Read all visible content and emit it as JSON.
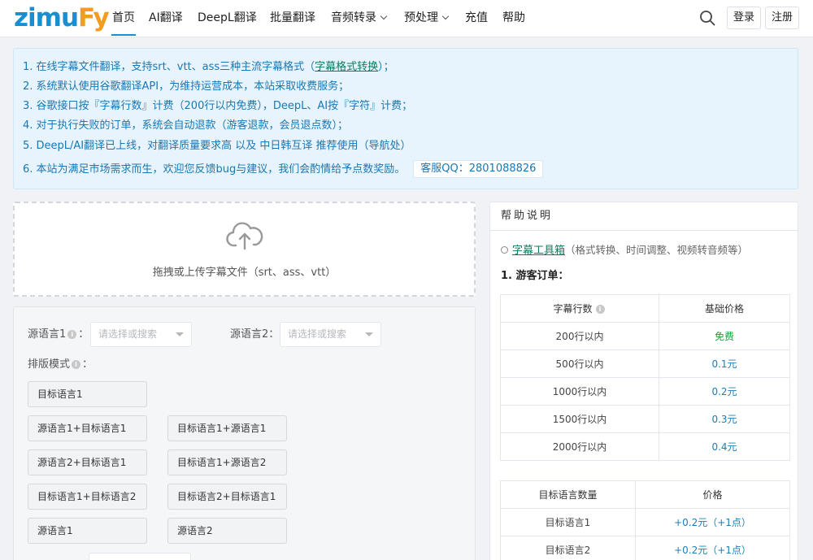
{
  "logo": {
    "part1": "zimu",
    "part2": "Fy"
  },
  "nav": {
    "items": [
      "首页",
      "AI翻译",
      "DeepL翻译",
      "批量翻译",
      "音频转录",
      "预处理",
      "充值",
      "帮助"
    ]
  },
  "header": {
    "login_label": "登录",
    "register_label": "注册"
  },
  "notice": {
    "line1_prefix": "1. 在线字幕文件翻译，支持srt、vtt、ass三种主流字幕格式（",
    "line1_link": "字幕格式转换",
    "line1_suffix": "）；",
    "line2": "2. 系统默认使用谷歌翻译API，为维持运营成本，本站采取收费服务；",
    "line3": "3. 谷歌接口按『字幕行数』计费（200行以内免费），DeepL、AI按『字符』计费；",
    "line4": "4. 对于执行失败的订单，系统会自动退款（游客退款，会员退点数）；",
    "line5": "5. DeepL/AI翻译已上线，对翻译质量要求高 以及 中日韩互译 推荐使用（导航处）",
    "line6": "6. 本站为满足市场需求而生，欢迎您反馈bug与建议，我们会酌情给予点数奖励。",
    "qq": "客服QQ：2801088826"
  },
  "upload": {
    "text": "拖拽或上传字幕文件（srt、ass、vtt）"
  },
  "settings": {
    "source_lang1_label": "源语言1",
    "source_lang2_label": "源语言2",
    "select_placeholder": "请选择或搜索",
    "colon": "：",
    "layout_label": "排版模式",
    "layout_options": [
      "目标语言1",
      "源语言1+目标语言1",
      "目标语言1+源语言1",
      "源语言2+目标语言1",
      "目标语言1+源语言2",
      "目标语言1+目标语言2",
      "目标语言2+目标语言1",
      "源语言1",
      "源语言2"
    ]
  },
  "help": {
    "title": "帮助说明",
    "toolbox_link": "字幕工具箱",
    "toolbox_desc": "（格式转换、时间调整、视频转音频等）",
    "guest_title": "1. 游客订单：",
    "table1": {
      "headers": [
        "字幕行数",
        "基础价格"
      ],
      "rows": [
        [
          "200行以内",
          "免费"
        ],
        [
          "500行以内",
          "0.1元"
        ],
        [
          "1000行以内",
          "0.2元"
        ],
        [
          "1500行以内",
          "0.3元"
        ],
        [
          "2000行以内",
          "0.4元"
        ]
      ]
    },
    "table2": {
      "headers": [
        "目标语言数量",
        "价格"
      ],
      "rows": [
        [
          "目标语言1",
          "+0.2元（+1点）"
        ],
        [
          "目标语言2",
          "+0.2元（+1点）"
        ]
      ]
    }
  },
  "colors": {
    "brand_blue": "#1a8fd0",
    "brand_orange": "#f39c1f",
    "link_green": "#0e7a5e",
    "free_green": "#1d9d3e"
  }
}
